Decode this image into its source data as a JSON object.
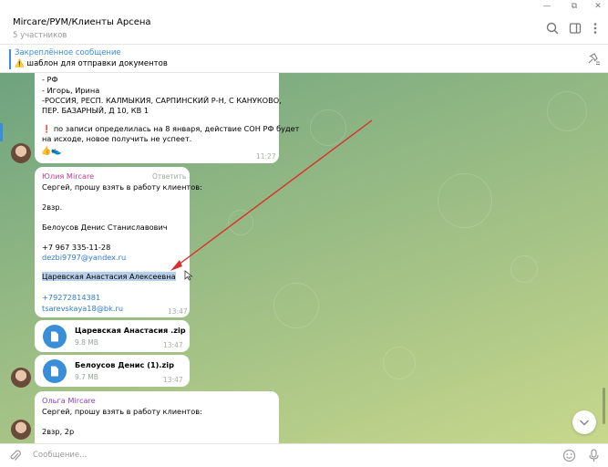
{
  "window": {
    "minimize_glyph": "—",
    "restore_glyph": "⧉",
    "close_glyph": "✕"
  },
  "header": {
    "title": "Mircare/РУМ/Клиенты Арсена",
    "subtitle": "5 участников",
    "icons": [
      "search-icon",
      "sidebar-toggle-icon",
      "more-vertical-icon"
    ]
  },
  "pinned": {
    "title": "Закреплённое сообщение",
    "warn_glyph": "⚠️",
    "text": "шаблон для отправки документов"
  },
  "messages": {
    "first": {
      "lines": [
        "- РФ",
        "- Игорь, Ирина",
        "-РОССИЯ, РЕСП. КАЛМЫКИЯ, САРПИНСКИЙ Р-Н, С КАНУКОВО,",
        "ПЕР. БАЗАРНЫЙ, Д 10, КВ 1",
        "по записи определилась на 8 января, действие СОН РФ будет",
        "на исходе, новое получить не успеет."
      ],
      "exclamation": "❗",
      "reactions": "👍👟",
      "time": "11:27"
    },
    "second": {
      "sender": "Юлия Mircare",
      "reply_label": "Ответить",
      "lines": [
        "Сергей, прошу взять в работу клиентов:",
        "2взр.",
        "Белоусов Денис Станиславович",
        "+7 967 335-11-28",
        "dezbi9797@yandex.ru",
        "Царевская Анастасия Алексеевна",
        "+79272814381",
        "tsarevskaya18@bk.ru"
      ],
      "time": "13:47"
    },
    "files": [
      {
        "name": "Царевская Анастасия .zip",
        "size": "9.8 MB",
        "time": "13:47"
      },
      {
        "name": "Белоусов Денис (1).zip",
        "size": "9.7 MB",
        "time": "13:47"
      }
    ],
    "third": {
      "sender": "Ольга Mircare",
      "lines": [
        "Сергей, прошу взять в работу клиентов:",
        "2взр, 2р"
      ]
    }
  },
  "composer": {
    "placeholder": "Сообщение..."
  },
  "colors": {
    "accent": "#3a8ed8",
    "sender_pink": "#c03d89",
    "sender_purple": "#8a3fbf",
    "annotation_arrow": "#d9302b"
  }
}
